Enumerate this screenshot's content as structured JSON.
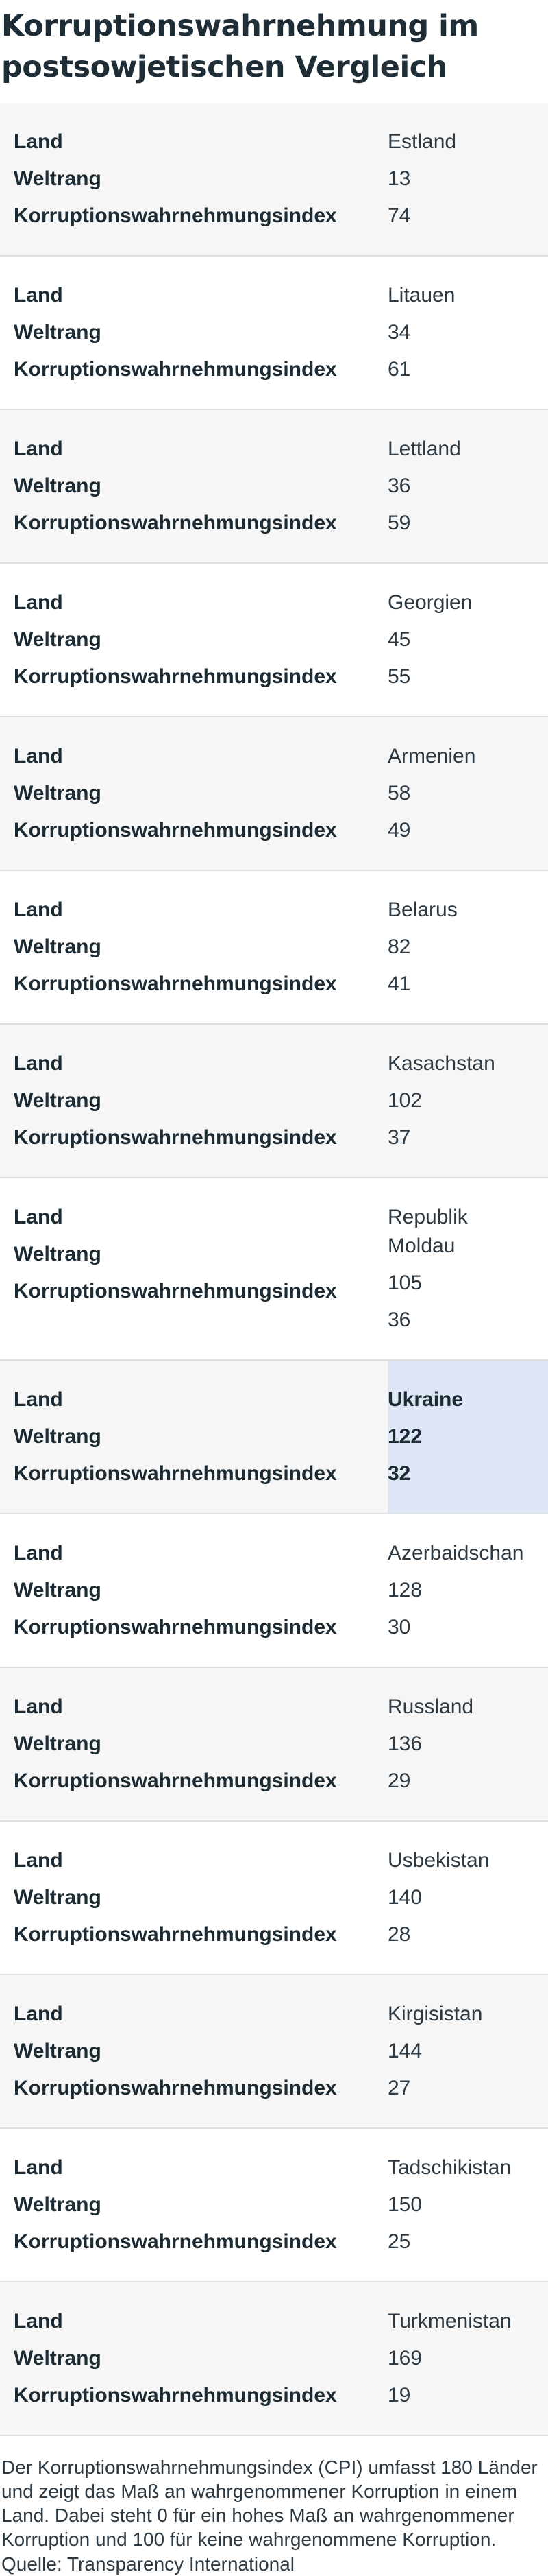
{
  "title": "Korruptionswahrnehmung im postsowjetischen Vergleich",
  "labels": {
    "land": "Land",
    "weltrang": "Weltrang",
    "index": "Korruptionswahrnehmungsindex"
  },
  "chart_data": {
    "type": "table",
    "columns": [
      "Land",
      "Weltrang",
      "Korruptionswahrnehmungsindex"
    ],
    "highlight": "Ukraine",
    "rows": [
      {
        "land": "Estland",
        "weltrang": "13",
        "index": "74"
      },
      {
        "land": "Litauen",
        "weltrang": "34",
        "index": "61"
      },
      {
        "land": "Lettland",
        "weltrang": "36",
        "index": "59"
      },
      {
        "land": "Georgien",
        "weltrang": "45",
        "index": "55"
      },
      {
        "land": "Armenien",
        "weltrang": "58",
        "index": "49"
      },
      {
        "land": "Belarus",
        "weltrang": "82",
        "index": "41"
      },
      {
        "land": "Kasachstan",
        "weltrang": "102",
        "index": "37"
      },
      {
        "land": "Republik Moldau",
        "weltrang": "105",
        "index": "36"
      },
      {
        "land": "Ukraine",
        "weltrang": "122",
        "index": "32"
      },
      {
        "land": "Azerbaidschan",
        "weltrang": "128",
        "index": "30"
      },
      {
        "land": "Russland",
        "weltrang": "136",
        "index": "29"
      },
      {
        "land": "Usbekistan",
        "weltrang": "140",
        "index": "28"
      },
      {
        "land": "Kirgisistan",
        "weltrang": "144",
        "index": "27"
      },
      {
        "land": "Tadschikistan",
        "weltrang": "150",
        "index": "25"
      },
      {
        "land": "Turkmenistan",
        "weltrang": "169",
        "index": "19"
      }
    ]
  },
  "note": "Der Korruptionswahrnehmungsindex (CPI) umfasst 180 Länder und zeigt das Maß an wahrgenommener Korruption in einem Land. Dabei steht 0 für ein hohes Maß an wahrgenommener Korruption und 100 für keine wahrgenommene Korruption.",
  "source": "Quelle: Transparency International"
}
